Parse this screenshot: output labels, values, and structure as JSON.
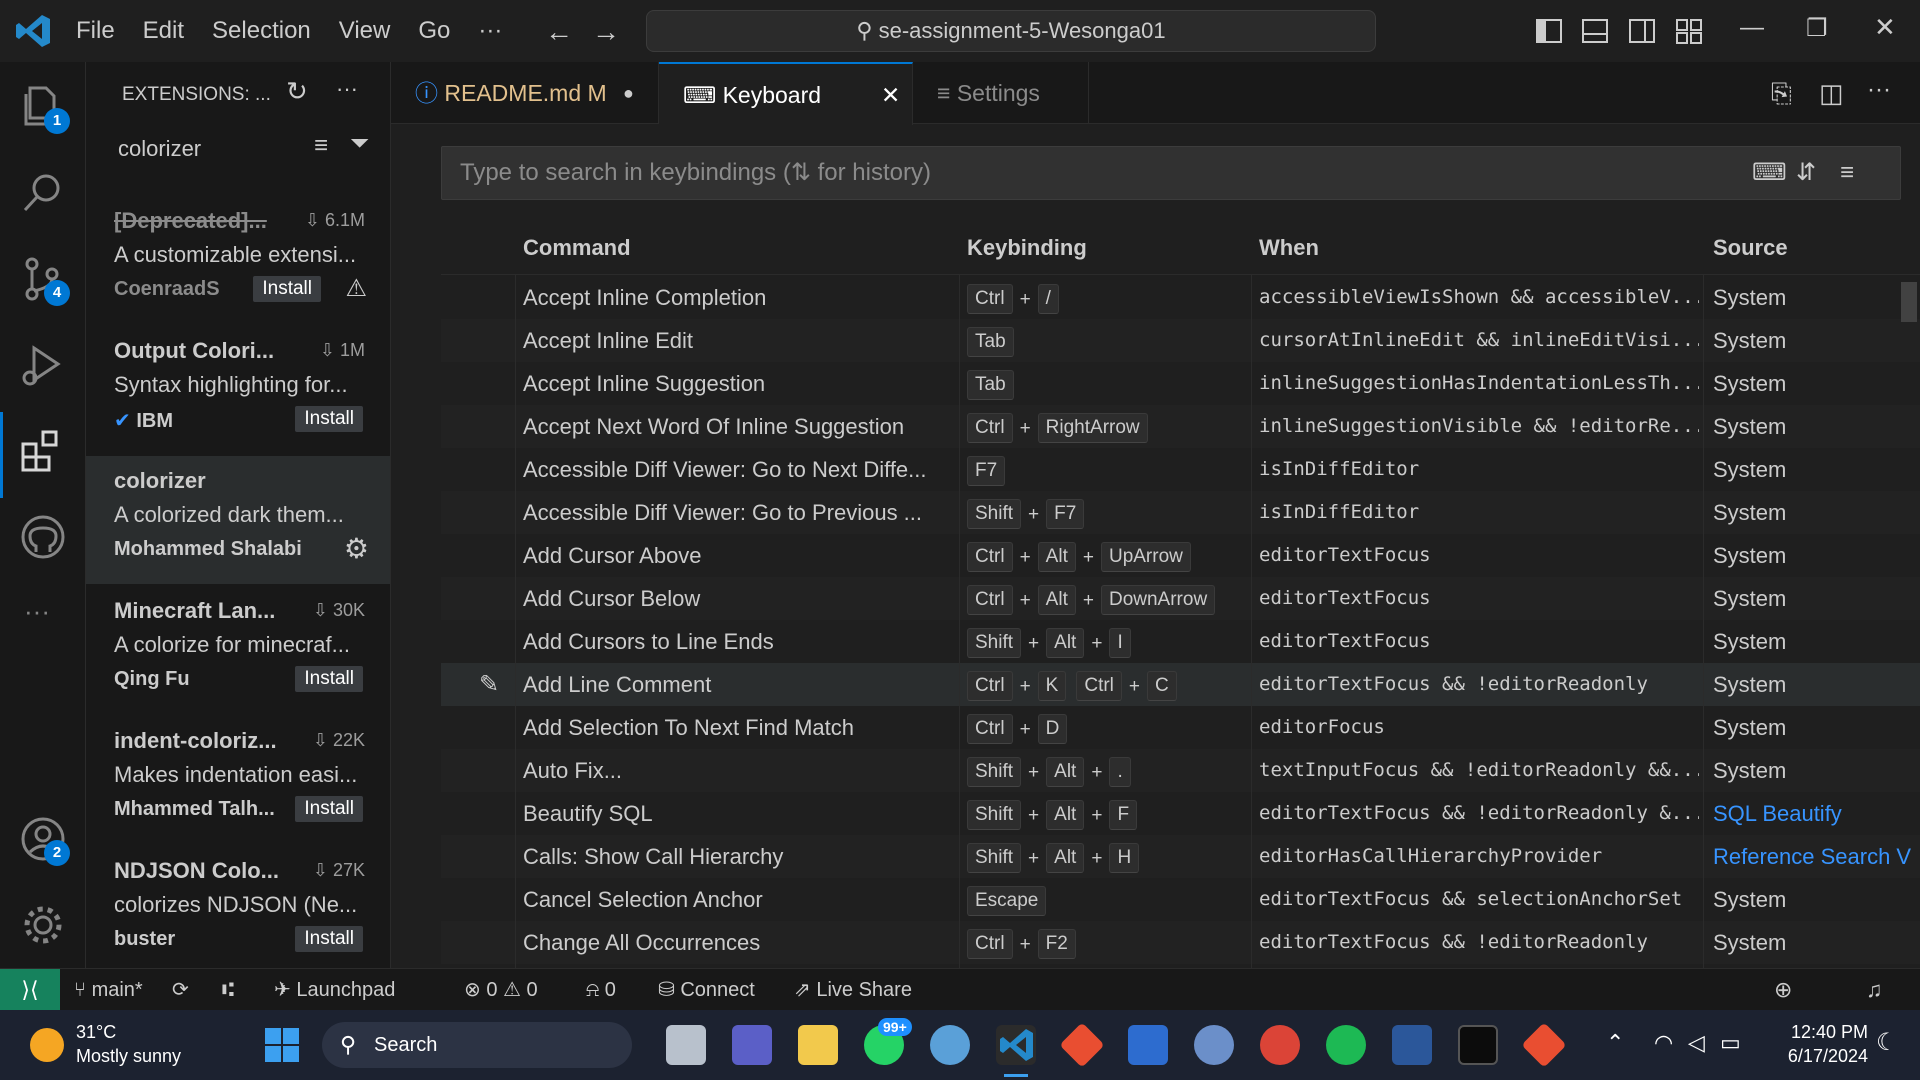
{
  "titlebar": {
    "menu": [
      "File",
      "Edit",
      "Selection",
      "View",
      "Go"
    ],
    "more": "···",
    "search": "se-assignment-5-Wesonga01"
  },
  "activity": {
    "explorer_badge": "1",
    "scm_badge": "4",
    "accounts_badge": "2",
    "more": "···"
  },
  "sidebar": {
    "title": "EXTENSIONS: ...",
    "query": "colorizer",
    "items": [
      {
        "name": "[Deprecated]...",
        "downloads": "6.1M",
        "desc": "A customizable extensi...",
        "publisher": "CoenraadS",
        "action": "Install"
      },
      {
        "name": "Output Colori...",
        "downloads": "1M",
        "desc": "Syntax highlighting for...",
        "publisher": "IBM",
        "action": "Install"
      },
      {
        "name": "colorizer",
        "downloads": "",
        "desc": "A colorized dark them...",
        "publisher": "Mohammed Shalabi",
        "action": ""
      },
      {
        "name": "Minecraft Lan...",
        "downloads": "30K",
        "desc": "A colorize for minecraf...",
        "publisher": "Qing Fu",
        "action": "Install"
      },
      {
        "name": "indent-coloriz...",
        "downloads": "22K",
        "desc": "Makes indentation easi...",
        "publisher": "Mhammed Talh...",
        "action": "Install"
      },
      {
        "name": "NDJSON Colo...",
        "downloads": "27K",
        "desc": "colorizes NDJSON (Ne...",
        "publisher": "buster",
        "action": "Install"
      }
    ]
  },
  "tabs": [
    {
      "label": "README.md",
      "mod": "M"
    },
    {
      "label": "Keyboard Shortcuts",
      "close": "✕"
    },
    {
      "label": "Settings"
    }
  ],
  "keybindings": {
    "search_placeholder": "Type to search in keybindings (⇅ for history)",
    "headers": {
      "command": "Command",
      "keybinding": "Keybinding",
      "when": "When",
      "source": "Source"
    },
    "rows": [
      {
        "command": "Accept Inline Completion",
        "keys": [
          [
            "Ctrl",
            "/"
          ]
        ],
        "when": "accessibleViewIsShown && accessibleV...",
        "source": "System"
      },
      {
        "command": "Accept Inline Edit",
        "keys": [
          [
            "Tab"
          ]
        ],
        "when": "cursorAtInlineEdit && inlineEditVisi...",
        "source": "System"
      },
      {
        "command": "Accept Inline Suggestion",
        "keys": [
          [
            "Tab"
          ]
        ],
        "when": "inlineSuggestionHasIndentationLessTh...",
        "source": "System"
      },
      {
        "command": "Accept Next Word Of Inline Suggestion",
        "keys": [
          [
            "Ctrl",
            "RightArrow"
          ]
        ],
        "when": "inlineSuggestionVisible && !editorRe...",
        "source": "System"
      },
      {
        "command": "Accessible Diff Viewer: Go to Next Diffe...",
        "keys": [
          [
            "F7"
          ]
        ],
        "when": "isInDiffEditor",
        "source": "System"
      },
      {
        "command": "Accessible Diff Viewer: Go to Previous ...",
        "keys": [
          [
            "Shift",
            "F7"
          ]
        ],
        "when": "isInDiffEditor",
        "source": "System"
      },
      {
        "command": "Add Cursor Above",
        "keys": [
          [
            "Ctrl",
            "Alt",
            "UpArrow"
          ]
        ],
        "when": "editorTextFocus",
        "source": "System"
      },
      {
        "command": "Add Cursor Below",
        "keys": [
          [
            "Ctrl",
            "Alt",
            "DownArrow"
          ]
        ],
        "when": "editorTextFocus",
        "source": "System"
      },
      {
        "command": "Add Cursors to Line Ends",
        "keys": [
          [
            "Shift",
            "Alt",
            "I"
          ]
        ],
        "when": "editorTextFocus",
        "source": "System"
      },
      {
        "command": "Add Line Comment",
        "keys": [
          [
            "Ctrl",
            "K"
          ],
          [
            "Ctrl",
            "C"
          ]
        ],
        "when": "editorTextFocus && !editorReadonly",
        "source": "System"
      },
      {
        "command": "Add Selection To Next Find Match",
        "keys": [
          [
            "Ctrl",
            "D"
          ]
        ],
        "when": "editorFocus",
        "source": "System"
      },
      {
        "command": "Auto Fix...",
        "keys": [
          [
            "Shift",
            "Alt",
            "."
          ]
        ],
        "when": "textInputFocus && !editorReadonly &&...",
        "source": "System"
      },
      {
        "command": "Beautify SQL",
        "keys": [
          [
            "Shift",
            "Alt",
            "F"
          ]
        ],
        "when": "editorTextFocus && !editorReadonly &...",
        "source": "SQL Beautify"
      },
      {
        "command": "Calls: Show Call Hierarchy",
        "keys": [
          [
            "Shift",
            "Alt",
            "H"
          ]
        ],
        "when": "editorHasCallHierarchyProvider",
        "source": "Reference Search V"
      },
      {
        "command": "Cancel Selection Anchor",
        "keys": [
          [
            "Escape"
          ]
        ],
        "when": "editorTextFocus && selectionAnchorSet",
        "source": "System"
      },
      {
        "command": "Change All Occurrences",
        "keys": [
          [
            "Ctrl",
            "F2"
          ]
        ],
        "when": "editorTextFocus && !editorReadonly",
        "source": "System"
      }
    ]
  },
  "statusbar": {
    "branch": "main*",
    "launchpad": "Launchpad",
    "errors": "0",
    "warnings": "0",
    "ports": "0",
    "connect": "Connect",
    "liveshare": "Live Share"
  },
  "taskbar": {
    "temp": "31°C",
    "weather": "Mostly sunny",
    "search": "Search",
    "whatsapp_badge": "99+",
    "time": "12:40 PM",
    "date": "6/17/2024"
  }
}
